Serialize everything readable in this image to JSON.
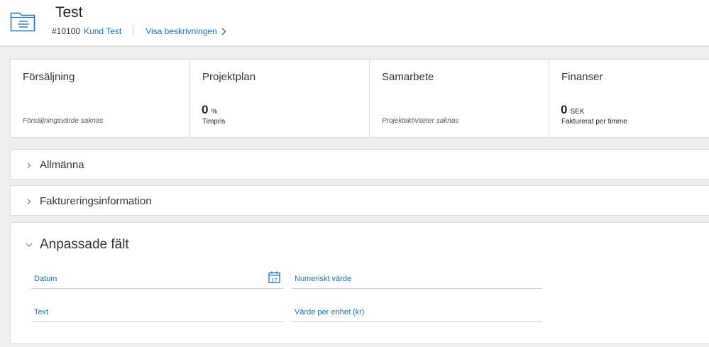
{
  "header": {
    "title": "Test",
    "project_number": "#10100",
    "customer_link": "Kund Test",
    "description_link": "Visa beskrivningen"
  },
  "cards": [
    {
      "title": "Försäljning",
      "note": "Försäljningsvärde saknas"
    },
    {
      "title": "Projektplan",
      "value": "0",
      "unit": "%",
      "sub": "Timpris"
    },
    {
      "title": "Samarbete",
      "note": "Projektaktiviteter saknas"
    },
    {
      "title": "Finanser",
      "value": "0",
      "unit": "SEK",
      "sub": "Fakturerat per timme"
    }
  ],
  "sections": {
    "general": {
      "title": "Allmänna",
      "expanded": false
    },
    "billing": {
      "title": "Faktureringsinformation",
      "expanded": false
    },
    "custom": {
      "title": "Anpassade fält",
      "expanded": true
    }
  },
  "custom_fields": {
    "date": {
      "label": "Datum",
      "icon": "calendar-icon"
    },
    "numeric": {
      "label": "Numeriskt värde"
    },
    "text": {
      "label": "Text"
    },
    "unit_value": {
      "label": "Värde per enhet (kr)"
    }
  },
  "colors": {
    "accent": "#1a73b8",
    "background": "#eeeeee",
    "border": "#dcdcdc"
  }
}
